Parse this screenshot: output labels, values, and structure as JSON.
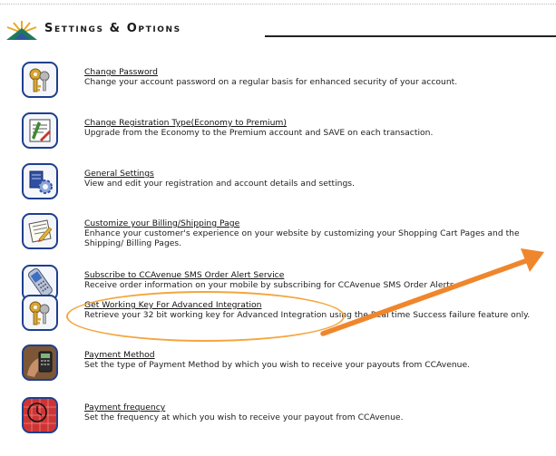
{
  "header": {
    "title": "Settings & Options",
    "logo_icon": "sunrise-triangle-logo"
  },
  "items": [
    {
      "label": "Change Password",
      "description": "Change your account password on a regular basis for enhanced security of your account.",
      "icon": "keys-icon"
    },
    {
      "label": "Change Registration Type(Economy to Premium)",
      "description": "Upgrade from the Economy to the Premium account and SAVE on each transaction.",
      "icon": "registration-icon"
    },
    {
      "label": "General Settings",
      "description": "View and edit your registration and account details and settings.",
      "icon": "gears-icon"
    },
    {
      "label": "Customize your Billing/Shipping Page",
      "description": "Enhance your customer's experience on your website by customizing your Shopping Cart Pages and the Shipping/ Billing Pages.",
      "icon": "edit-document-icon"
    },
    {
      "label": "Subscribe to CCAvenue SMS Order Alert Service",
      "description": "Receive order information on your mobile by subscribing for CCAvenue SMS Order Alerts.",
      "icon": "mobile-phone-icon"
    },
    {
      "label": "Get Working Key For Advanced Integration",
      "description": "Retrieve your 32 bit working key for Advanced Integration using the Real time Success failure feature only.",
      "icon": "keys-icon"
    },
    {
      "label": "Payment Method",
      "description": "Set the type of Payment Method by which you wish to receive your payouts from CCAvenue.",
      "icon": "card-machine-icon"
    },
    {
      "label": "Payment frequency",
      "description": "Set the frequency at which you wish to receive your payout from CCAvenue.",
      "icon": "clock-calendar-icon"
    }
  ],
  "colors": {
    "icon_border": "#1f3f8d",
    "highlight": "#f3a63e",
    "title_rule": "#222222"
  }
}
